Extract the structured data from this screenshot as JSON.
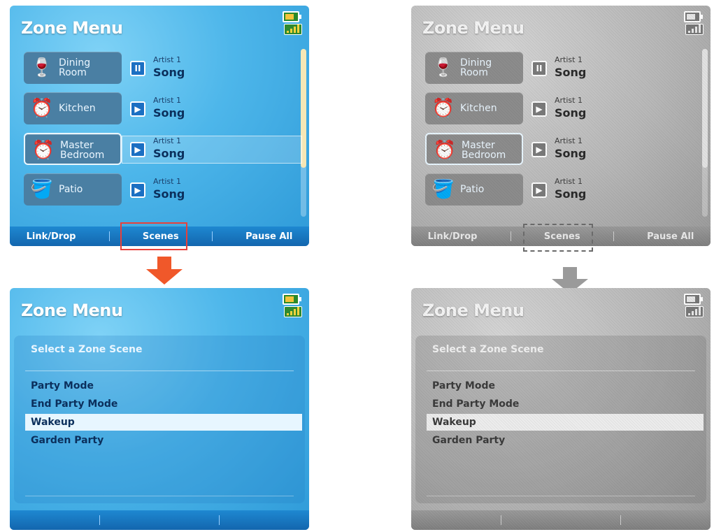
{
  "app": {
    "title": "Zone Menu"
  },
  "zones": [
    {
      "name": "Dining\nRoom",
      "icon": "glass-icon",
      "artist": "Artist 1",
      "song": "Song",
      "control": "pause",
      "control_glyph": "II"
    },
    {
      "name": "Kitchen",
      "icon": "alarm-clock-icon",
      "artist": "Artist 1",
      "song": "Song",
      "control": "play",
      "control_glyph": "▶"
    },
    {
      "name": "Master\nBedroom",
      "icon": "alarm-clock-icon",
      "artist": "Artist 1",
      "song": "Song",
      "control": "play",
      "control_glyph": "▶"
    },
    {
      "name": "Patio",
      "icon": "watering-can-icon",
      "artist": "Artist 1",
      "song": "Song",
      "control": "play",
      "control_glyph": "▶"
    }
  ],
  "softkeys": {
    "left": "Link/Drop",
    "center": "Scenes",
    "right": "Pause All"
  },
  "scene_panel": {
    "title": "Select a Zone Scene",
    "items": [
      "Party Mode",
      "End Party Mode",
      "Wakeup",
      "Garden Party"
    ],
    "selected": "Wakeup"
  },
  "colors": {
    "highlight_box": "#e8403a",
    "arrow": "#f0582a",
    "softkey_bar": "#1e88d1"
  }
}
